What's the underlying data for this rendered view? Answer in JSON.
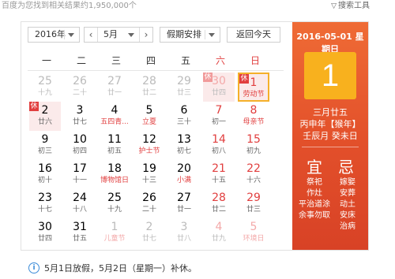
{
  "topbar": {
    "results": "百度为您找到相关结果约1,950,000个",
    "tools": "搜索工具",
    "tools_icon": "filter-icon"
  },
  "controls": {
    "year": "2016年",
    "month": "5月",
    "prev": "‹",
    "next": "›",
    "holiday": "假期安排",
    "back_today": "返回今天"
  },
  "weekdays": [
    "一",
    "二",
    "三",
    "四",
    "五",
    "六",
    "日"
  ],
  "weeks": [
    [
      {
        "d": "25",
        "l": "十九",
        "other": true
      },
      {
        "d": "26",
        "l": "二十",
        "other": true
      },
      {
        "d": "27",
        "l": "廿一",
        "other": true
      },
      {
        "d": "28",
        "l": "廿二",
        "other": true
      },
      {
        "d": "29",
        "l": "廿三",
        "other": true
      },
      {
        "d": "30",
        "l": "廿四",
        "other": true,
        "weekend": true,
        "badge": "休",
        "holiday": true
      },
      {
        "d": "1",
        "l": "劳动节",
        "weekend": true,
        "badge": "休",
        "holiday": true,
        "selected": true,
        "festival": true
      }
    ],
    [
      {
        "d": "2",
        "l": "廿六",
        "badge": "休",
        "holiday": true
      },
      {
        "d": "3",
        "l": "廿七"
      },
      {
        "d": "4",
        "l": "五四青...",
        "festival": true
      },
      {
        "d": "5",
        "l": "立夏",
        "festival": true
      },
      {
        "d": "6",
        "l": "三十"
      },
      {
        "d": "7",
        "l": "初一",
        "weekend": true
      },
      {
        "d": "8",
        "l": "母亲节",
        "weekend": true,
        "festival": true
      }
    ],
    [
      {
        "d": "9",
        "l": "初三"
      },
      {
        "d": "10",
        "l": "初四"
      },
      {
        "d": "11",
        "l": "初五"
      },
      {
        "d": "12",
        "l": "护士节",
        "festival": true
      },
      {
        "d": "13",
        "l": "初七"
      },
      {
        "d": "14",
        "l": "初八",
        "weekend": true
      },
      {
        "d": "15",
        "l": "初九",
        "weekend": true
      }
    ],
    [
      {
        "d": "16",
        "l": "初十"
      },
      {
        "d": "17",
        "l": "十一"
      },
      {
        "d": "18",
        "l": "博物馆日",
        "festival": true
      },
      {
        "d": "19",
        "l": "十三"
      },
      {
        "d": "20",
        "l": "小满",
        "festival": true
      },
      {
        "d": "21",
        "l": "十五",
        "weekend": true
      },
      {
        "d": "22",
        "l": "十六",
        "weekend": true
      }
    ],
    [
      {
        "d": "23",
        "l": "十七"
      },
      {
        "d": "24",
        "l": "十八"
      },
      {
        "d": "25",
        "l": "十九"
      },
      {
        "d": "26",
        "l": "二十"
      },
      {
        "d": "27",
        "l": "廿一"
      },
      {
        "d": "28",
        "l": "廿二",
        "weekend": true
      },
      {
        "d": "29",
        "l": "廿三",
        "weekend": true
      }
    ],
    [
      {
        "d": "30",
        "l": "廿四"
      },
      {
        "d": "31",
        "l": "廿五"
      },
      {
        "d": "1",
        "l": "儿童节",
        "other": true,
        "festival": true
      },
      {
        "d": "2",
        "l": "廿七",
        "other": true
      },
      {
        "d": "3",
        "l": "廿八",
        "other": true
      },
      {
        "d": "4",
        "l": "廿九",
        "other": true,
        "weekend": true
      },
      {
        "d": "5",
        "l": "环境日",
        "other": true,
        "weekend": true,
        "festival": true
      }
    ]
  ],
  "side": {
    "date_line": "2016-05-01 星期日",
    "big_day": "1",
    "lunar_date": "三月廿五",
    "ganzhi_year": "丙申年【猴年】",
    "ganzhi_month_day": "壬辰月 癸未日",
    "yi_title": "宜",
    "ji_title": "忌",
    "yi": [
      "祭祀",
      "作灶",
      "平治道涂",
      "余事勿取"
    ],
    "ji": [
      "嫁娶",
      "安葬",
      "动土",
      "安床",
      "治病"
    ]
  },
  "notice": {
    "icon": "info-icon",
    "text": "5月1日放假，5月2日（星期一）补休。"
  },
  "colors": {
    "weekend_red": "#e13e3e",
    "holiday_bg": "#fbeaea",
    "selected_border": "#f5b02a",
    "side_orange": "#e85a2c",
    "big_box": "#f8b11e",
    "info_blue": "#3b8bd8"
  }
}
